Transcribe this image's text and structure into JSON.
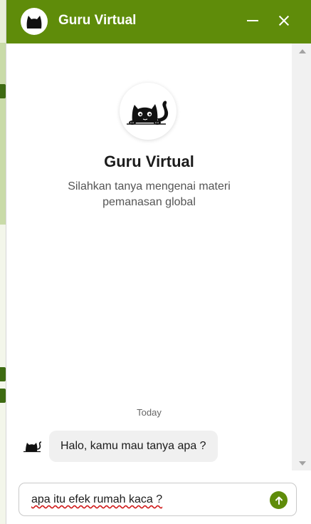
{
  "header": {
    "title": "Guru Virtual",
    "avatar_icon": "cat-icon",
    "minimize_icon": "minimize-icon",
    "close_icon": "close-icon"
  },
  "intro": {
    "title": "Guru Virtual",
    "subtitle": "Silahkan tanya mengenai materi pemanasan global",
    "avatar_icon": "cat-peeking-icon"
  },
  "conversation": {
    "day_label": "Today",
    "messages": [
      {
        "sender": "bot",
        "text": "Halo, kamu mau tanya apa ?"
      }
    ]
  },
  "composer": {
    "value": "apa itu efek rumah kaca ?",
    "send_icon": "arrow-up-icon"
  },
  "colors": {
    "brand": "#5f8c0a",
    "bubble": "#f0f0f0",
    "header_text": "#ffffff"
  }
}
